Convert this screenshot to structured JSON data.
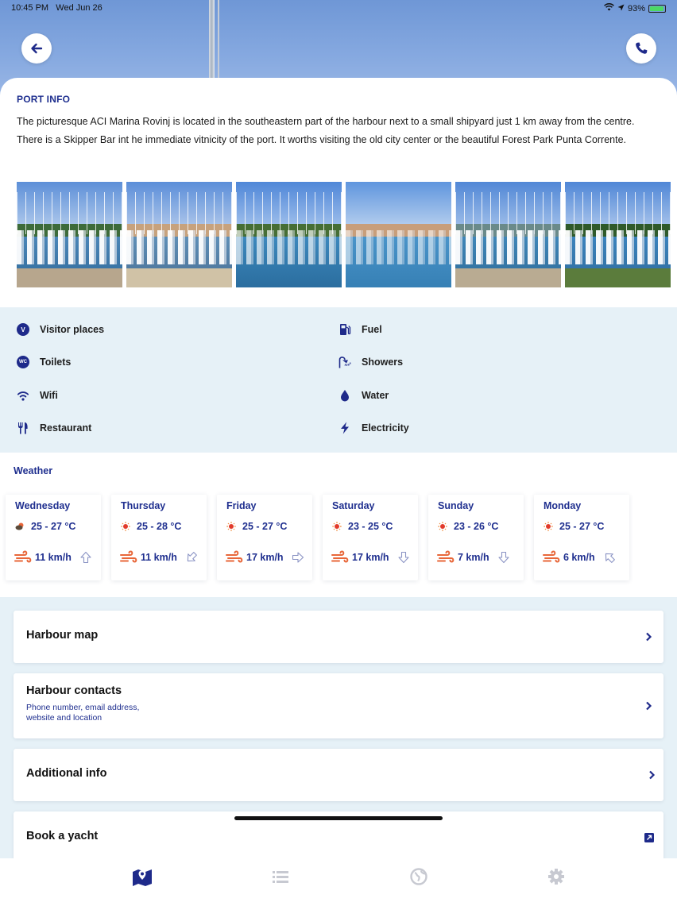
{
  "status": {
    "time": "10:45 PM",
    "date": "Wed Jun 26",
    "battery": "93%",
    "battery_level": 0.93
  },
  "header": {
    "back_label": "Back",
    "call_label": "Call"
  },
  "port_info": {
    "title": "PORT INFO",
    "description": "The picturesque ACI Marina Rovinj is located in the southeastern part of the harbour next to a small shipyard just 1 km away from the centre. There is a Skipper Bar int he immediate vitnicity of the port. It worths visiting the old city center or the beautiful Forest Park Punta Corrente."
  },
  "facilities": {
    "left": [
      {
        "label": "Visitor places",
        "icon": "visitor-places-icon"
      },
      {
        "label": "Toilets",
        "icon": "toilets-icon"
      },
      {
        "label": "Wifi",
        "icon": "wifi-icon"
      },
      {
        "label": "Restaurant",
        "icon": "restaurant-icon"
      }
    ],
    "right": [
      {
        "label": "Fuel",
        "icon": "fuel-icon"
      },
      {
        "label": "Showers",
        "icon": "shower-icon"
      },
      {
        "label": "Water",
        "icon": "water-drop-icon"
      },
      {
        "label": "Electricity",
        "icon": "lightning-icon"
      }
    ]
  },
  "weather": {
    "title": "Weather",
    "days": [
      {
        "day": "Wednesday",
        "temp": "25 - 27 °C",
        "wind": "11 km/h",
        "icon": "cloudy-sun-icon",
        "wind_dir": "up"
      },
      {
        "day": "Thursday",
        "temp": "25 - 28 °C",
        "wind": "11 km/h",
        "icon": "sun-icon",
        "wind_dir": "down-left"
      },
      {
        "day": "Friday",
        "temp": "25 - 27 °C",
        "wind": "17 km/h",
        "icon": "sun-icon",
        "wind_dir": "right"
      },
      {
        "day": "Saturday",
        "temp": "23 - 25 °C",
        "wind": "17 km/h",
        "icon": "sun-icon",
        "wind_dir": "down"
      },
      {
        "day": "Sunday",
        "temp": "23 - 26 °C",
        "wind": "7 km/h",
        "icon": "sun-icon",
        "wind_dir": "down"
      },
      {
        "day": "Monday",
        "temp": "25 - 27 °C",
        "wind": "6 km/h",
        "icon": "sun-icon",
        "wind_dir": "up-left"
      }
    ]
  },
  "menu": {
    "harbour_map": "Harbour map",
    "harbour_contacts": "Harbour contacts",
    "harbour_contacts_sub1": "Phone number, email address,",
    "harbour_contacts_sub2": "website and location",
    "additional_info": "Additional info",
    "book_yacht": "Book a yacht"
  },
  "tabs": [
    "map-icon",
    "list-icon",
    "globe-icon",
    "gear-icon"
  ],
  "colors": {
    "accent": "#1f2f8f",
    "wind": "#e8673a",
    "panel": "#e6f1f7"
  }
}
